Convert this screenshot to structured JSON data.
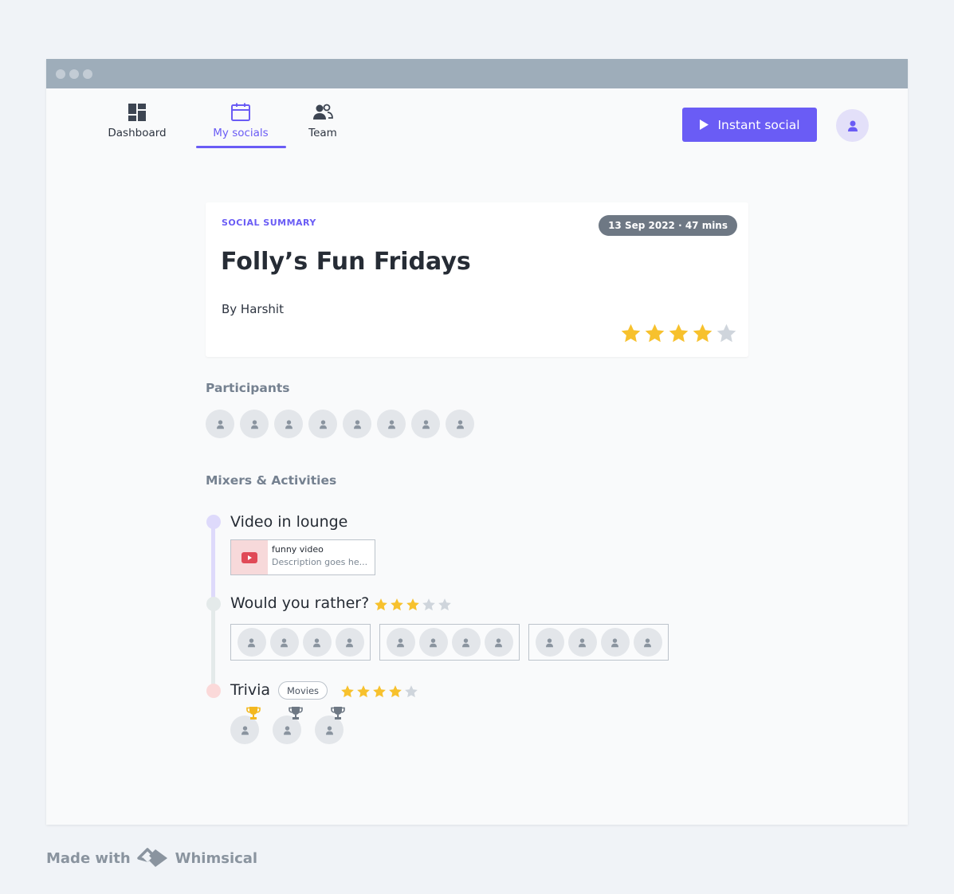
{
  "nav": {
    "items": [
      {
        "label": "Dashboard",
        "icon": "dashboard-icon"
      },
      {
        "label": "My socials",
        "icon": "calendar-icon",
        "active": true
      },
      {
        "label": "Team",
        "icon": "team-icon"
      }
    ],
    "instant_button": "Instant social",
    "accent": "#6a5cf5"
  },
  "summary": {
    "eyebrow": "SOCIAL SUMMARY",
    "date_duration": "13 Sep 2022 · 47 mins",
    "title": "Folly’s Fun Fridays",
    "by": "By Harshit",
    "rating": 4,
    "rating_max": 5
  },
  "participants": {
    "label": "Participants",
    "count": 8
  },
  "activities": {
    "label": "Mixers & Activities",
    "items": [
      {
        "title": "Video in lounge",
        "video": {
          "title": "funny video",
          "description": "Description goes he..."
        }
      },
      {
        "title": "Would you rather?",
        "rating": 3,
        "groups": [
          4,
          4,
          4
        ]
      },
      {
        "title": "Trivia",
        "tag": "Movies",
        "rating": 4,
        "winners": [
          "gold",
          "silver",
          "bronze"
        ]
      }
    ]
  },
  "footer": {
    "made_with": "Made with",
    "brand": "Whimsical"
  }
}
